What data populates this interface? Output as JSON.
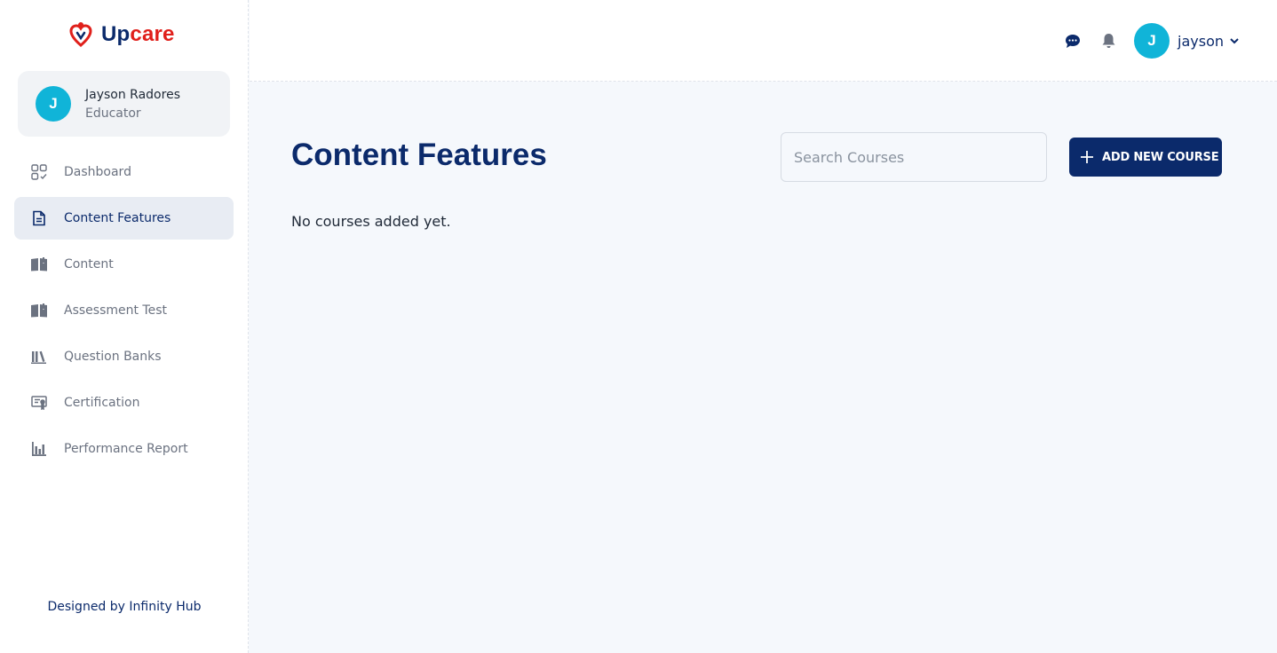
{
  "brand": {
    "name_part1": "Up",
    "name_part2": "care",
    "logo_icon": "heart-person-logo"
  },
  "profile": {
    "initial": "J",
    "name": "Jayson Radores",
    "role": "Educator"
  },
  "nav": {
    "items": [
      {
        "label": "Dashboard",
        "icon": "dashboard-icon",
        "active": false
      },
      {
        "label": "Content Features",
        "icon": "document-icon",
        "active": true
      },
      {
        "label": "Content",
        "icon": "book-icon",
        "active": false
      },
      {
        "label": "Assessment Test",
        "icon": "book-icon",
        "active": false
      },
      {
        "label": "Question Banks",
        "icon": "library-icon",
        "active": false
      },
      {
        "label": "Certification",
        "icon": "certificate-icon",
        "active": false
      },
      {
        "label": "Performance Report",
        "icon": "bar-chart-icon",
        "active": false
      }
    ]
  },
  "footer": {
    "credit": "Designed by Infinity Hub"
  },
  "topbar": {
    "user_initial": "J",
    "username": "jayson",
    "icons": [
      "chat-icon",
      "bell-icon",
      "chevron-down-icon"
    ]
  },
  "main": {
    "title": "Content Features",
    "search_placeholder": "Search Courses",
    "add_button_label": "ADD NEW COURSE",
    "empty_message": "No courses added yet."
  },
  "colors": {
    "primary": "#0b2a6b",
    "accent_red": "#e0201b",
    "avatar": "#10b4d8",
    "background": "#f5f8fc"
  }
}
